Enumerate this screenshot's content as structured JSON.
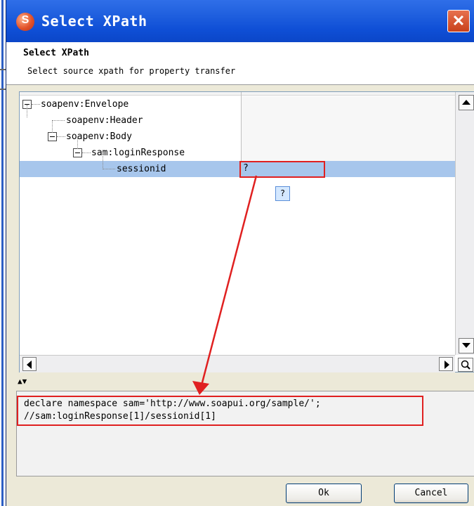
{
  "window": {
    "title": "Select XPath",
    "app_icon": "soapui-logo-icon",
    "close_label": "✕"
  },
  "header": {
    "title": "Select XPath",
    "description": "Select source xpath for property transfer"
  },
  "tree": {
    "nodes": [
      {
        "label": "soapenv:Envelope",
        "value": ""
      },
      {
        "label": "soapenv:Header",
        "value": ""
      },
      {
        "label": "soapenv:Body",
        "value": ""
      },
      {
        "label": "sam:loginResponse",
        "value": ""
      },
      {
        "label": "sessionid",
        "value": "?"
      }
    ],
    "selected_index": 4,
    "tooltip": "?"
  },
  "splitter": {
    "arrows": "▲▼"
  },
  "xpath": {
    "line1": "declare namespace sam='http://www.soapui.org/sample/';",
    "line2": "//sam:loginResponse[1]/sessionid[1]"
  },
  "buttons": {
    "ok": "Ok",
    "cancel": "Cancel"
  },
  "colors": {
    "annotation": "#e02020",
    "selection": "#a7c6ec",
    "titlebar": "#1f5fe0"
  }
}
